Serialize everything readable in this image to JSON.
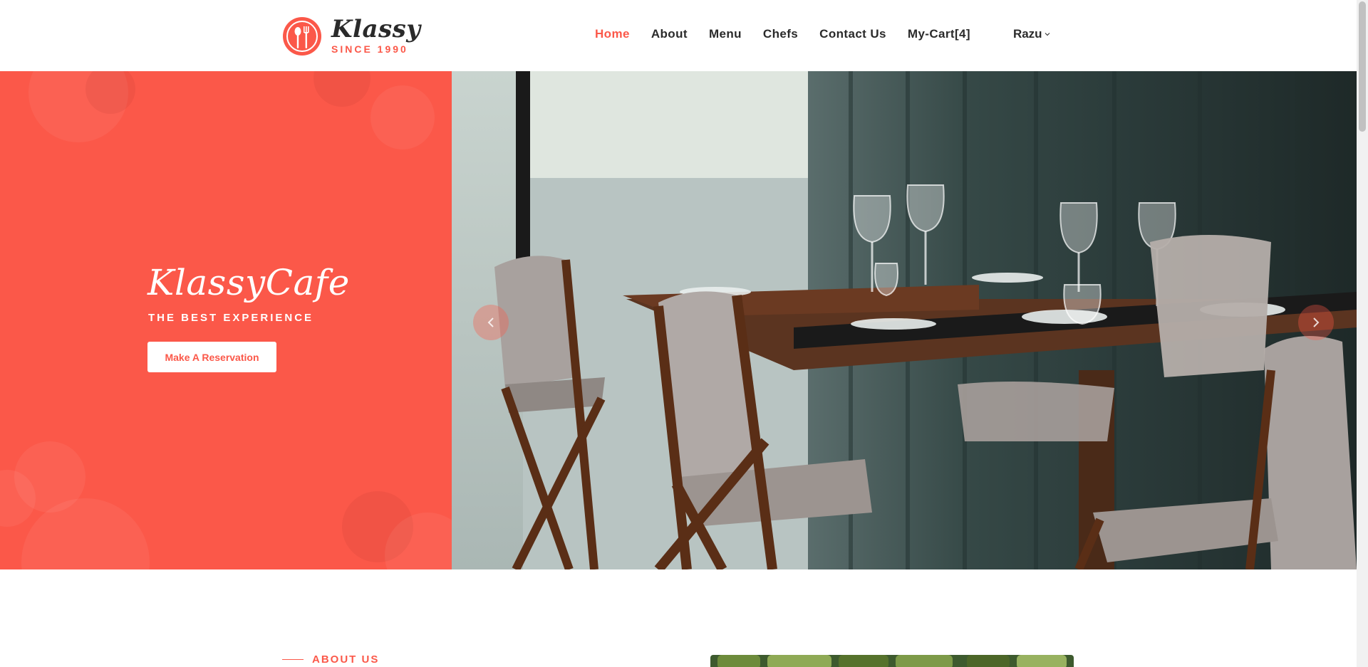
{
  "brand": {
    "name": "Klassy",
    "since": "SINCE 1990",
    "accent": "#fb5849"
  },
  "nav": {
    "items": [
      {
        "label": "Home",
        "active": true
      },
      {
        "label": "About",
        "active": false
      },
      {
        "label": "Menu",
        "active": false
      },
      {
        "label": "Chefs",
        "active": false
      },
      {
        "label": "Contact Us",
        "active": false
      },
      {
        "label": "My-Cart[4]",
        "active": false
      }
    ],
    "user": "Razu"
  },
  "hero": {
    "title": "KlassyCafe",
    "subtitle": "THE BEST EXPERIENCE",
    "button": "Make A Reservation",
    "prev_icon": "chevron-left-icon",
    "next_icon": "chevron-right-icon"
  },
  "about": {
    "label": "ABOUT US"
  }
}
